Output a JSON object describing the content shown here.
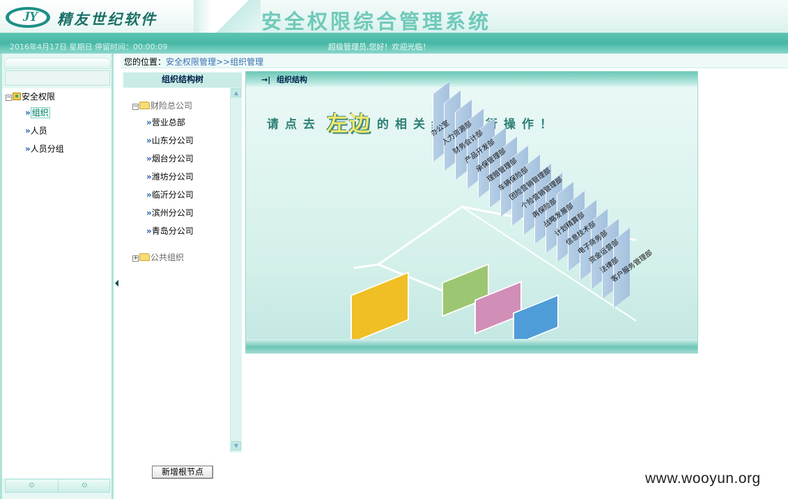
{
  "header": {
    "logo_letters": "JY",
    "company_name": "精友世纪软件",
    "system_title": "安全权限综合管理系统",
    "date_info": "2016年4月17日 星期日 停留时间：00:00:09",
    "welcome": "超级管理员,您好！欢迎光临！"
  },
  "left_nav": {
    "root_label": "安全权限",
    "items": [
      {
        "label": "组织",
        "active": true
      },
      {
        "label": "人员",
        "active": false
      },
      {
        "label": "人员分组",
        "active": false
      }
    ],
    "bottom_buttons": [
      "down-circle-icon",
      "up-circle-icon"
    ]
  },
  "breadcrumb": {
    "label": "您的位置：",
    "path": "安全权限管理>>组织管理"
  },
  "org_tree": {
    "header": "组织结构树",
    "root": "财险总公司",
    "children": [
      "营业总部",
      "山东分公司",
      "烟台分公司",
      "潍坊分公司",
      "临沂分公司",
      "滨州分公司",
      "青岛分公司"
    ],
    "other_root": "公共组织"
  },
  "buttons": {
    "add_root_label": "新增根节点"
  },
  "main_panel": {
    "title_icon": "→|",
    "title": "组织结构",
    "instruction_before": "请点去",
    "instruction_keyword": "左边",
    "instruction_after": "的相关组织进行操作！",
    "departments": [
      "办公室",
      "人力资源部",
      "财务会计部",
      "产品开发部",
      "承保管理部",
      "理赔管理部",
      "车辆保险部",
      "团险营销管理部",
      "个险营销管理部",
      "再保险部",
      "战略发展部",
      "计划精算部",
      "信息技术部",
      "电子商务部",
      "资金运营部",
      "法律部",
      "客户服务管理部"
    ],
    "block_colors": [
      "#f0be25",
      "#9dc672",
      "#d18eb7",
      "#4f9dd8"
    ]
  },
  "watermark": "www.wooyun.org"
}
